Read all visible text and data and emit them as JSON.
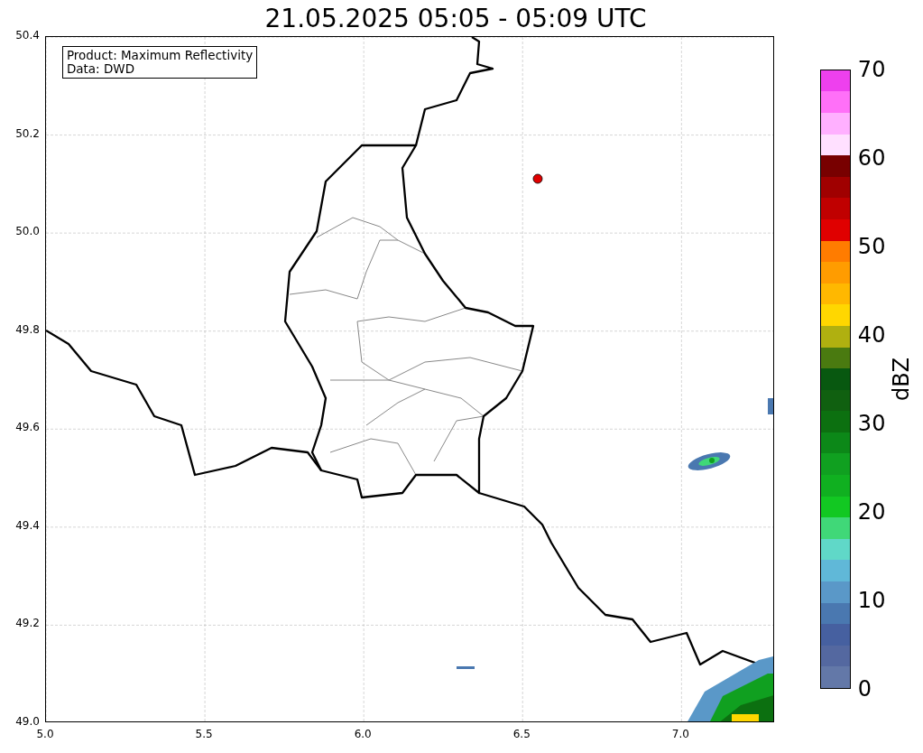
{
  "title": "21.05.2025 05:05 - 05:09 UTC",
  "info_box": [
    "Product: Maximum Reflectivity",
    "Data: DWD"
  ],
  "x_ticks": [
    "5.0",
    "5.5",
    "6.0",
    "6.5",
    "7.0"
  ],
  "y_ticks": [
    "50.4",
    "50.2",
    "50.0",
    "49.8",
    "49.6",
    "49.4",
    "49.2",
    "49.0"
  ],
  "colorbar": {
    "label": "dBZ",
    "ticks": [
      "70",
      "60",
      "50",
      "40",
      "30",
      "20",
      "10",
      "0"
    ],
    "segments": [
      {
        "color": "#6378a8"
      },
      {
        "color": "#5468a0"
      },
      {
        "color": "#4660a0"
      },
      {
        "color": "#4a78b0"
      },
      {
        "color": "#5a98c8"
      },
      {
        "color": "#60b8d8"
      },
      {
        "color": "#60d8c8"
      },
      {
        "color": "#40d878"
      },
      {
        "color": "#12c822"
      },
      {
        "color": "#10b020"
      },
      {
        "color": "#10a020"
      },
      {
        "color": "#0c8818"
      },
      {
        "color": "#0c7010"
      },
      {
        "color": "#106010"
      },
      {
        "color": "#085810"
      },
      {
        "color": "#4a7a10"
      },
      {
        "color": "#b0b010"
      },
      {
        "color": "#ffd700"
      },
      {
        "color": "#ffb800"
      },
      {
        "color": "#ff9c00"
      },
      {
        "color": "#ff7c00"
      },
      {
        "color": "#e00000"
      },
      {
        "color": "#c00000"
      },
      {
        "color": "#a00000"
      },
      {
        "color": "#780000"
      },
      {
        "color": "#ffe0ff"
      },
      {
        "color": "#ffb0ff"
      },
      {
        "color": "#ff70f8"
      },
      {
        "color": "#ee40ee"
      }
    ]
  }
}
